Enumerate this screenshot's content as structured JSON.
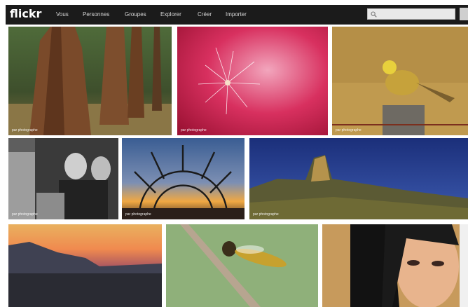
{
  "header": {
    "logo": "flickr",
    "nav": [
      "Vous",
      "Personnes",
      "Groupes",
      "Explorer",
      "Créer",
      "Importer"
    ],
    "search_placeholder": ""
  },
  "photos": [
    {
      "name": "photo-sequoia-forest",
      "caption": "par photographe"
    },
    {
      "name": "photo-pink-dandelion",
      "caption": "par photographe"
    },
    {
      "name": "photo-yellowhammer-bird",
      "caption": "par photographe"
    },
    {
      "name": "photo-old-men-bw",
      "caption": "par photographe"
    },
    {
      "name": "photo-sunset-structure",
      "caption": "par photographe"
    },
    {
      "name": "photo-mountain-landscape",
      "caption": "par photographe"
    },
    {
      "name": "photo-sunset-lake",
      "caption": ""
    },
    {
      "name": "photo-hoverfly",
      "caption": ""
    },
    {
      "name": "photo-woman-portrait",
      "caption": ""
    }
  ]
}
